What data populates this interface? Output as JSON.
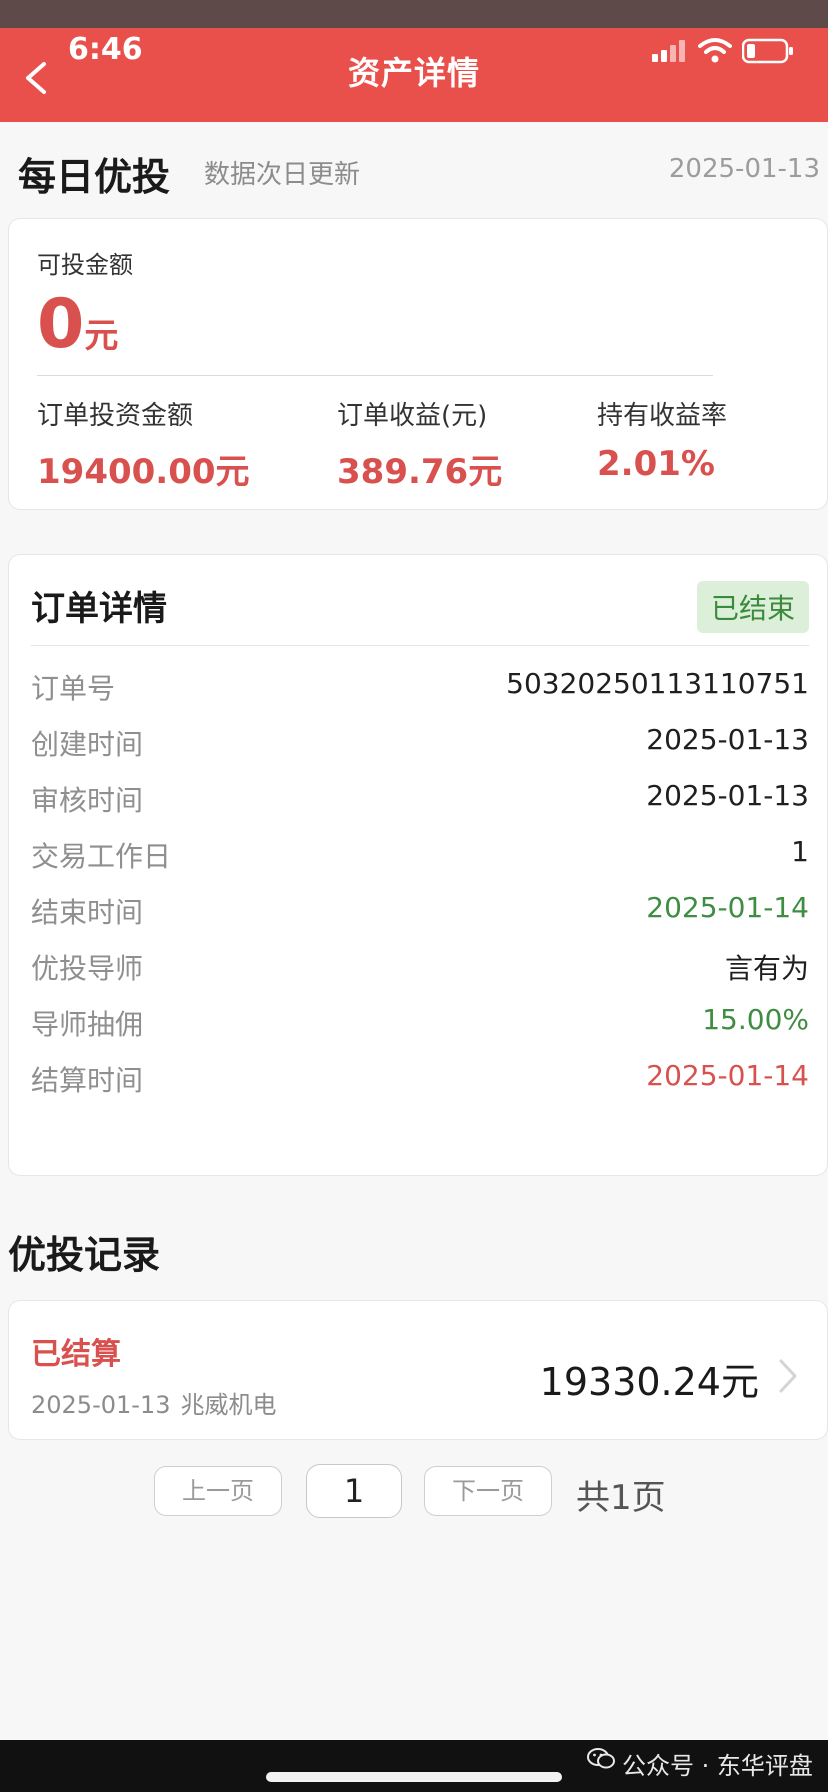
{
  "status_bar": {
    "time": "6:46"
  },
  "header": {
    "title": "资产详情",
    "back_icon": "chevron-left-icon"
  },
  "daily": {
    "title": "每日优投",
    "subtitle": "数据次日更新",
    "date": "2025-01-13"
  },
  "assets": {
    "available_label": "可投金额",
    "available_value": "0",
    "available_unit": "元",
    "stats": [
      {
        "label": "订单投资金额",
        "value": "19400.00元"
      },
      {
        "label": "订单收益(元)",
        "value": "389.76元"
      },
      {
        "label": "持有收益率",
        "value": "2.01%"
      }
    ]
  },
  "order": {
    "title": "订单详情",
    "status": "已结束",
    "rows": [
      {
        "label": "订单号",
        "value": "50320250113110751"
      },
      {
        "label": "创建时间",
        "value": "2025-01-13"
      },
      {
        "label": "审核时间",
        "value": "2025-01-13"
      },
      {
        "label": "交易工作日",
        "value": "1"
      },
      {
        "label": "结束时间",
        "value": "2025-01-14"
      },
      {
        "label": "优投导师",
        "value": "言有为"
      },
      {
        "label": "导师抽佣",
        "value": "15.00%"
      },
      {
        "label": "结算时间",
        "value": "2025-01-14"
      }
    ]
  },
  "records": {
    "title": "优投记录",
    "items": [
      {
        "status": "已结算",
        "date": "2025-01-13",
        "stock": "兆威机电",
        "amount": "19330.24元"
      }
    ]
  },
  "pagination": {
    "prev": "上一页",
    "current": "1",
    "next": "下一页",
    "total": "共1页"
  },
  "watermark": "公众号 · 东华评盘",
  "colors": {
    "header_bg": "#e9504b",
    "accent_red": "#d8514e",
    "accent_green": "#3f8d43",
    "badge_bg": "#dcefd8"
  }
}
